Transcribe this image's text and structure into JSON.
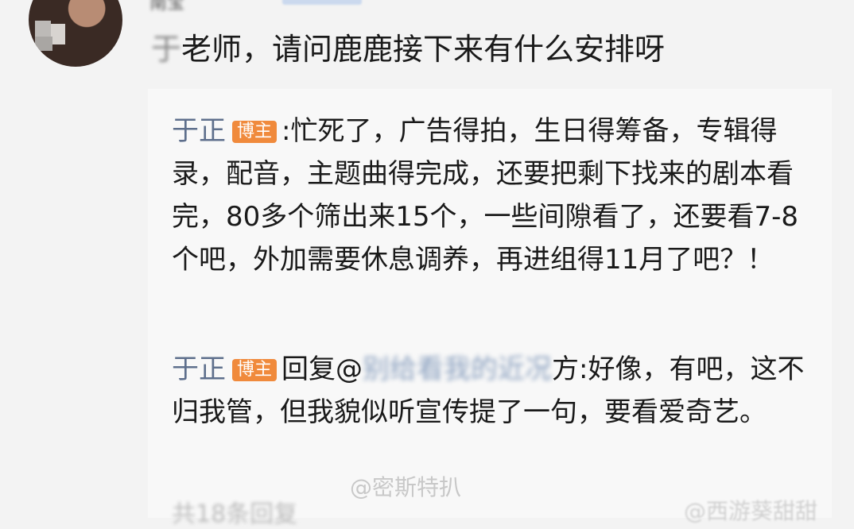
{
  "comment": {
    "username": "南宝",
    "question_prefix": "于",
    "question": "老师，请问鹿鹿接下来有什么安排呀"
  },
  "replies": [
    {
      "author": "于正",
      "badge": "博主",
      "separator": ":",
      "text": "忙死了，广告得拍，生日得筹备，专辑得录，配音，主题曲得完成，还要把剩下找来的剧本看完，80多个筛出来15个，一些间隙看了，还要看7-8个吧，外加需要休息调养，再进组得11月了吧？！"
    },
    {
      "author": "于正",
      "badge": "博主",
      "reply_prefix": "回复@",
      "blurred_target": "别给看我的近况",
      "target_suffix": "方:",
      "text": "好像，有吧，这不归我管，但我貌似听宣传提了一句，要看爱奇艺。"
    }
  ],
  "watermark": "@密斯特扒",
  "watermark2": "@西游葵甜甜",
  "bottom_cut": "共18条回复"
}
